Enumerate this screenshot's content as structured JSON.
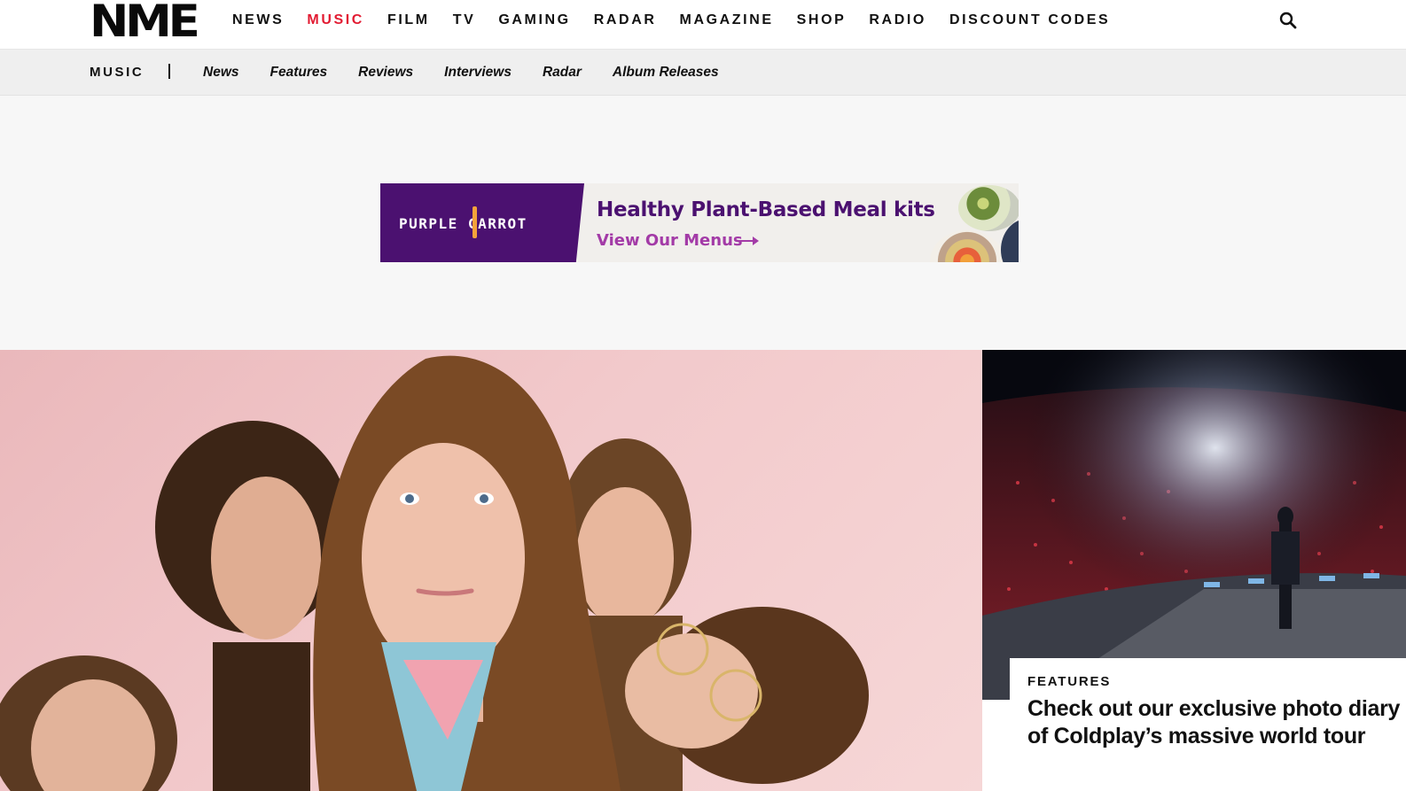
{
  "header": {
    "logo": "NME",
    "nav": [
      "NEWS",
      "MUSIC",
      "FILM",
      "TV",
      "GAMING",
      "RADAR",
      "MAGAZINE",
      "SHOP",
      "RADIO",
      "DISCOUNT CODES"
    ],
    "active_nav": "MUSIC",
    "search_icon": "search-icon",
    "accent_color": "#e21b32"
  },
  "subnav": {
    "section": "MUSIC",
    "items": [
      "News",
      "Features",
      "Reviews",
      "Interviews",
      "Radar",
      "Album Releases"
    ]
  },
  "ad": {
    "brand": "PURPLE CARROT",
    "headline": "Healthy Plant-Based Meal kits",
    "cta": "View Our Menus",
    "brand_color": "#4b1170",
    "cta_color": "#a33ba7"
  },
  "hero": {
    "image": "band-portrait-pink-background"
  },
  "side_article": {
    "image": "concert-stadium-stage",
    "tag": "FEATURES",
    "title": "Check out our exclusive photo diary of Coldplay’s massive world tour"
  }
}
